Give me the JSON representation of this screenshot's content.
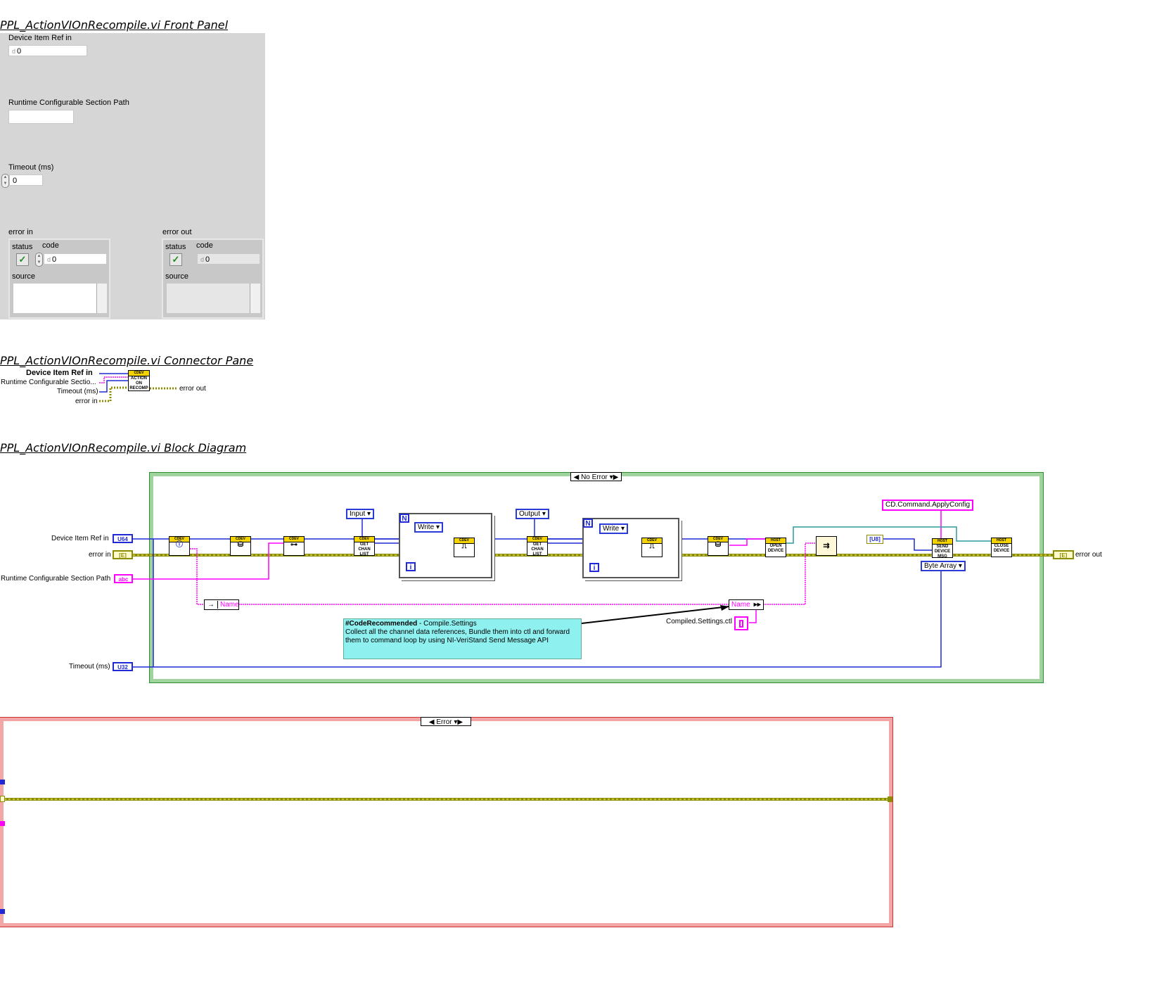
{
  "front_panel": {
    "title": "PPL_ActionVIOnRecompile.vi Front Panel",
    "device_item_ref": {
      "label": "Device Item Ref in",
      "value": "0"
    },
    "section_path": {
      "label": "Runtime Configurable Section Path",
      "value": ""
    },
    "timeout": {
      "label": "Timeout (ms)",
      "value": "0"
    },
    "error_in": {
      "label": "error in",
      "status_label": "status",
      "code_label": "code",
      "code_value": "0",
      "source_label": "source"
    },
    "error_out": {
      "label": "error out",
      "status_label": "status",
      "code_label": "code",
      "code_value": "0",
      "source_label": "source"
    }
  },
  "connector_pane": {
    "title": "PPL_ActionVIOnRecompile.vi Connector Pane",
    "inputs": [
      "Device Item Ref in",
      "Runtime Configurable Sectio...",
      "Timeout (ms)",
      "error in"
    ],
    "output": "error out",
    "icon_text": [
      "CDEV",
      "ACTION",
      "ON",
      "RECOMP"
    ]
  },
  "block_diagram": {
    "title": "PPL_ActionVIOnRecompile.vi Block Diagram",
    "case_no_error": "No Error",
    "case_error": "Error",
    "terminals": {
      "device_item_ref": "Device Item Ref in",
      "error_in": "error in",
      "section_path": "Runtime Configurable Section Path",
      "timeout": "Timeout (ms)",
      "error_out": "error out"
    },
    "term_types": {
      "u64": "U64",
      "err": "[E]",
      "abc": "abc",
      "u32": "U32",
      "u8": "[U8]"
    },
    "enums": {
      "input": "Input",
      "output": "Output",
      "write1": "Write",
      "write2": "Write",
      "byte_array": "Byte Array"
    },
    "constants": {
      "command": "CD.Command.ApplyConfig",
      "ctl": "Compiled.Settings.ctl"
    },
    "unbundle_name_1": "Name",
    "unbundle_name_2": "Name",
    "loop_count": "N",
    "loop_index": "i",
    "vi_labels": {
      "get_chan_list_1": "GET CHAN LIST",
      "get_chan_list_2": "GET CHAN LIST",
      "open_device": "OPEN DEVICE",
      "send_device_msg": "SEND DEVICE MSG",
      "close_device": "CLOSE DEVICE",
      "cdev": "CDEV",
      "host": "HOST"
    },
    "comment": {
      "tag": "#CodeRecommended",
      "subject": " - Compile.Settings",
      "text": "Collect all the channel data references, Bundle them into ctl and forward them to command loop by using NI-VeriStand Send Message API"
    }
  },
  "colors": {
    "error_wire": "#8c8c00",
    "string_wire": "#ff00ff",
    "int_wire": "#1f2ad6",
    "no_error_frame": "#9fd49f",
    "error_frame": "#f2a6a6",
    "comment_bg": "#8ff0f0"
  }
}
